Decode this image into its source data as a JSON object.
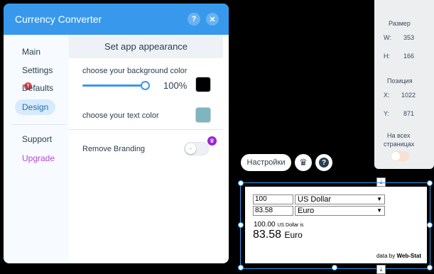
{
  "dialog": {
    "title": "Currency Converter",
    "help_glyph": "?",
    "close_glyph": "✕",
    "nav": {
      "main": "Main",
      "settings": "Settings",
      "settings_badge": "!",
      "defaults": "Defaults",
      "design": "Design",
      "support": "Support",
      "upgrade": "Upgrade"
    },
    "panel": {
      "title": "Set app appearance",
      "bg_color_label": "choose your background color",
      "bg_opacity": "100%",
      "bg_opacity_value": 1.0,
      "bg_color": "#000000",
      "text_color_label": "choose your text color",
      "text_color": "#7fb5be",
      "remove_branding_label": "Remove Branding",
      "remove_branding_on": false
    }
  },
  "size_panel": {
    "size_title": "Размер",
    "w_label": "W:",
    "w_value": "353",
    "h_label": "H:",
    "h_value": "166",
    "position_title": "Позиция",
    "x_label": "X:",
    "x_value": "1022",
    "y_label": "Y:",
    "y_value": "871",
    "all_pages_line1": "На всех",
    "all_pages_line2": "страницах"
  },
  "toolbar": {
    "settings_label": "Настройки",
    "crown_icon": "crown-icon",
    "help_glyph": "?"
  },
  "widget": {
    "amount1": "100",
    "currency1": "US Dollar",
    "amount2": "83.58",
    "currency2": "Euro",
    "line_amount": "100.00",
    "line_currency": "US Dollar is",
    "result_value": "83.58",
    "result_currency": "Euro",
    "credit_prefix": "data by",
    "credit_brand": "Web-Stat"
  },
  "colors": {
    "accent": "#3899ec",
    "upgrade": "#bb46d8",
    "premium": "#9a27d5",
    "warning": "#e5484d"
  }
}
